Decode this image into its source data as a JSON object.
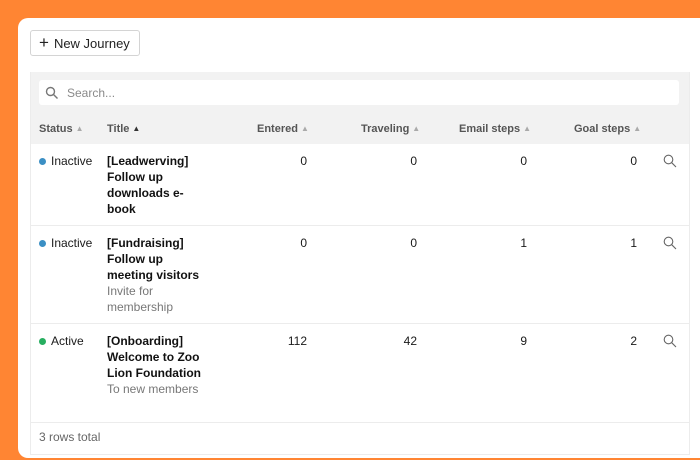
{
  "toolbar": {
    "new_button_label": "New Journey"
  },
  "search": {
    "placeholder": "Search..."
  },
  "columns": {
    "status": "Status",
    "title": "Title",
    "entered": "Entered",
    "traveling": "Traveling",
    "email_steps": "Email steps",
    "goal_steps": "Goal steps"
  },
  "colors": {
    "inactive": "#3b8fc4",
    "active": "#27ae60",
    "brand": "#ff8533"
  },
  "rows": [
    {
      "status": "Inactive",
      "title": "[Leadwerving] Follow up downloads e-book",
      "description": "",
      "entered": "0",
      "traveling": "0",
      "email_steps": "0",
      "goal_steps": "0"
    },
    {
      "status": "Inactive",
      "title": "[Fundraising] Follow up meeting visitors",
      "description": "Invite for membership",
      "entered": "0",
      "traveling": "0",
      "email_steps": "1",
      "goal_steps": "1"
    },
    {
      "status": "Active",
      "title": "[Onboarding] Welcome to Zoo Lion Foundation",
      "description": "To new members",
      "entered": "112",
      "traveling": "42",
      "email_steps": "9",
      "goal_steps": "2"
    }
  ],
  "footer": {
    "total": "3 rows total"
  }
}
